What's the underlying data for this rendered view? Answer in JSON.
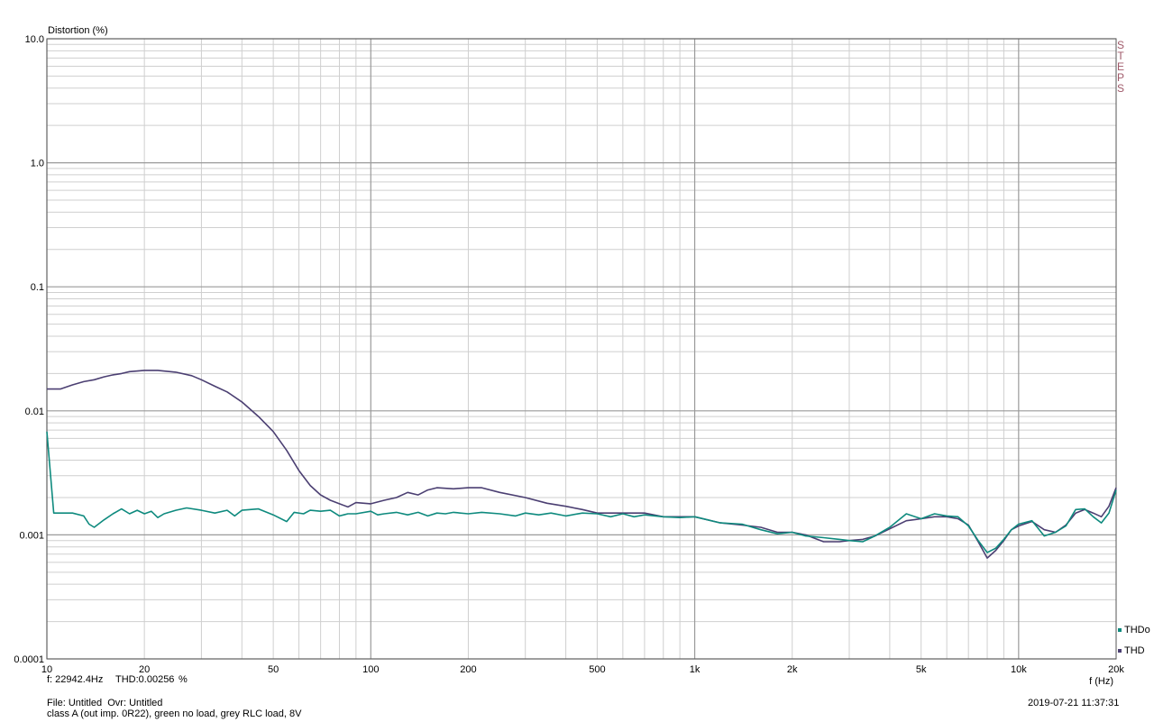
{
  "chart_data": {
    "type": "line",
    "title": "",
    "ylabel": "Distortion (%)",
    "xlabel": "f (Hz)",
    "x_scale": "log",
    "y_scale": "log",
    "xlim": [
      10,
      20000
    ],
    "ylim": [
      0.0001,
      10
    ],
    "grid": true,
    "legend_position": "bottom-right",
    "x_tick_labels": [
      {
        "value": 10,
        "label": "10"
      },
      {
        "value": 20,
        "label": "20"
      },
      {
        "value": 50,
        "label": "50"
      },
      {
        "value": 100,
        "label": "100"
      },
      {
        "value": 200,
        "label": "200"
      },
      {
        "value": 500,
        "label": "500"
      },
      {
        "value": 1000,
        "label": "1k"
      },
      {
        "value": 2000,
        "label": "2k"
      },
      {
        "value": 5000,
        "label": "5k"
      },
      {
        "value": 10000,
        "label": "10k"
      },
      {
        "value": 20000,
        "label": "20k"
      }
    ],
    "y_tick_labels": [
      {
        "value": 10,
        "label": "10.0"
      },
      {
        "value": 1,
        "label": "1.0"
      },
      {
        "value": 0.1,
        "label": "0.1"
      },
      {
        "value": 0.01,
        "label": "0.01"
      },
      {
        "value": 0.001,
        "label": "0.001"
      },
      {
        "value": 0.0001,
        "label": "0.0001"
      }
    ],
    "side_label": "STEPS",
    "series": [
      {
        "name": "THD",
        "color": "#4b3f72",
        "points": [
          [
            10,
            0.015
          ],
          [
            11,
            0.015
          ],
          [
            12,
            0.0162
          ],
          [
            13,
            0.0172
          ],
          [
            14,
            0.0178
          ],
          [
            15,
            0.0188
          ],
          [
            16,
            0.0195
          ],
          [
            17,
            0.02
          ],
          [
            18,
            0.0207
          ],
          [
            20,
            0.0212
          ],
          [
            22,
            0.0212
          ],
          [
            25,
            0.0205
          ],
          [
            28,
            0.0192
          ],
          [
            30,
            0.0178
          ],
          [
            33,
            0.0158
          ],
          [
            36,
            0.0142
          ],
          [
            40,
            0.0118
          ],
          [
            45,
            0.009
          ],
          [
            50,
            0.0068
          ],
          [
            55,
            0.0048
          ],
          [
            60,
            0.0033
          ],
          [
            65,
            0.0025
          ],
          [
            70,
            0.0021
          ],
          [
            75,
            0.0019
          ],
          [
            80,
            0.00178
          ],
          [
            85,
            0.00168
          ],
          [
            90,
            0.00182
          ],
          [
            100,
            0.00178
          ],
          [
            110,
            0.0019
          ],
          [
            120,
            0.002
          ],
          [
            130,
            0.0022
          ],
          [
            140,
            0.0021
          ],
          [
            150,
            0.0023
          ],
          [
            160,
            0.0024
          ],
          [
            180,
            0.00235
          ],
          [
            200,
            0.0024
          ],
          [
            220,
            0.0024
          ],
          [
            250,
            0.0022
          ],
          [
            300,
            0.002
          ],
          [
            350,
            0.0018
          ],
          [
            400,
            0.0017
          ],
          [
            450,
            0.0016
          ],
          [
            500,
            0.0015
          ],
          [
            600,
            0.0015
          ],
          [
            700,
            0.0015
          ],
          [
            800,
            0.0014
          ],
          [
            1000,
            0.0014
          ],
          [
            1200,
            0.00125
          ],
          [
            1400,
            0.0012
          ],
          [
            1600,
            0.00115
          ],
          [
            1800,
            0.00105
          ],
          [
            2000,
            0.00105
          ],
          [
            2200,
            0.001
          ],
          [
            2500,
            0.00088
          ],
          [
            2800,
            0.00088
          ],
          [
            3000,
            0.0009
          ],
          [
            3300,
            0.00092
          ],
          [
            3600,
            0.00098
          ],
          [
            4000,
            0.00112
          ],
          [
            4500,
            0.0013
          ],
          [
            5000,
            0.00135
          ],
          [
            5500,
            0.0014
          ],
          [
            6000,
            0.0014
          ],
          [
            6500,
            0.00135
          ],
          [
            7000,
            0.0012
          ],
          [
            7500,
            0.00088
          ],
          [
            8000,
            0.00065
          ],
          [
            8500,
            0.00075
          ],
          [
            9000,
            0.0009
          ],
          [
            9500,
            0.0011
          ],
          [
            10000,
            0.00118
          ],
          [
            11000,
            0.00128
          ],
          [
            12000,
            0.0011
          ],
          [
            13000,
            0.00105
          ],
          [
            14000,
            0.0012
          ],
          [
            15000,
            0.0015
          ],
          [
            16000,
            0.0016
          ],
          [
            17000,
            0.0015
          ],
          [
            18000,
            0.0014
          ],
          [
            19000,
            0.0017
          ],
          [
            20000,
            0.0024
          ]
        ]
      },
      {
        "name": "THDo",
        "color": "#0e8a7e",
        "points": [
          [
            10,
            0.0068
          ],
          [
            10.5,
            0.0015
          ],
          [
            11,
            0.0015
          ],
          [
            12,
            0.0015
          ],
          [
            13,
            0.00142
          ],
          [
            13.5,
            0.00122
          ],
          [
            14,
            0.00115
          ],
          [
            15,
            0.00132
          ],
          [
            16,
            0.00148
          ],
          [
            17,
            0.00162
          ],
          [
            18,
            0.00148
          ],
          [
            19,
            0.00158
          ],
          [
            20,
            0.00148
          ],
          [
            21,
            0.00155
          ],
          [
            22,
            0.00138
          ],
          [
            23,
            0.00148
          ],
          [
            25,
            0.00158
          ],
          [
            27,
            0.00165
          ],
          [
            30,
            0.00158
          ],
          [
            33,
            0.0015
          ],
          [
            36,
            0.00158
          ],
          [
            38,
            0.00142
          ],
          [
            40,
            0.00158
          ],
          [
            45,
            0.00162
          ],
          [
            50,
            0.00145
          ],
          [
            55,
            0.00128
          ],
          [
            58,
            0.00152
          ],
          [
            62,
            0.00148
          ],
          [
            65,
            0.00158
          ],
          [
            70,
            0.00155
          ],
          [
            75,
            0.00158
          ],
          [
            80,
            0.00142
          ],
          [
            85,
            0.00148
          ],
          [
            90,
            0.00148
          ],
          [
            100,
            0.00155
          ],
          [
            105,
            0.00145
          ],
          [
            110,
            0.00148
          ],
          [
            120,
            0.00152
          ],
          [
            130,
            0.00145
          ],
          [
            140,
            0.00152
          ],
          [
            150,
            0.00142
          ],
          [
            160,
            0.0015
          ],
          [
            170,
            0.00148
          ],
          [
            180,
            0.00152
          ],
          [
            200,
            0.00148
          ],
          [
            220,
            0.00152
          ],
          [
            250,
            0.00148
          ],
          [
            280,
            0.00142
          ],
          [
            300,
            0.0015
          ],
          [
            330,
            0.00145
          ],
          [
            360,
            0.0015
          ],
          [
            400,
            0.00142
          ],
          [
            450,
            0.0015
          ],
          [
            500,
            0.00148
          ],
          [
            550,
            0.0014
          ],
          [
            600,
            0.00148
          ],
          [
            650,
            0.0014
          ],
          [
            700,
            0.00145
          ],
          [
            800,
            0.0014
          ],
          [
            900,
            0.00138
          ],
          [
            1000,
            0.0014
          ],
          [
            1200,
            0.00125
          ],
          [
            1400,
            0.00122
          ],
          [
            1600,
            0.0011
          ],
          [
            1800,
            0.00102
          ],
          [
            2000,
            0.00105
          ],
          [
            2200,
            0.00098
          ],
          [
            2500,
            0.00095
          ],
          [
            2800,
            0.00092
          ],
          [
            3000,
            0.0009
          ],
          [
            3300,
            0.00088
          ],
          [
            3600,
            0.00098
          ],
          [
            4000,
            0.00115
          ],
          [
            4500,
            0.00148
          ],
          [
            5000,
            0.00135
          ],
          [
            5500,
            0.00148
          ],
          [
            6000,
            0.00142
          ],
          [
            6500,
            0.0014
          ],
          [
            7000,
            0.00118
          ],
          [
            7500,
            0.0009
          ],
          [
            8000,
            0.00072
          ],
          [
            8500,
            0.00078
          ],
          [
            9000,
            0.00092
          ],
          [
            9500,
            0.0011
          ],
          [
            10000,
            0.00122
          ],
          [
            11000,
            0.0013
          ],
          [
            12000,
            0.00098
          ],
          [
            13000,
            0.00105
          ],
          [
            14000,
            0.00118
          ],
          [
            15000,
            0.0016
          ],
          [
            16000,
            0.00162
          ],
          [
            17000,
            0.0014
          ],
          [
            18000,
            0.00125
          ],
          [
            19000,
            0.0015
          ],
          [
            20000,
            0.0023
          ]
        ]
      }
    ]
  },
  "readout": {
    "frequency": "f: 22942.4Hz",
    "thd": "THD:0.00256",
    "unit": "%"
  },
  "footer": {
    "file_line": "File: Untitled  Ovr: Untitled",
    "description": "class A (out imp. 0R22), green no load, grey RLC load, 8V",
    "timestamp": "2019-07-21 11:37:31"
  }
}
